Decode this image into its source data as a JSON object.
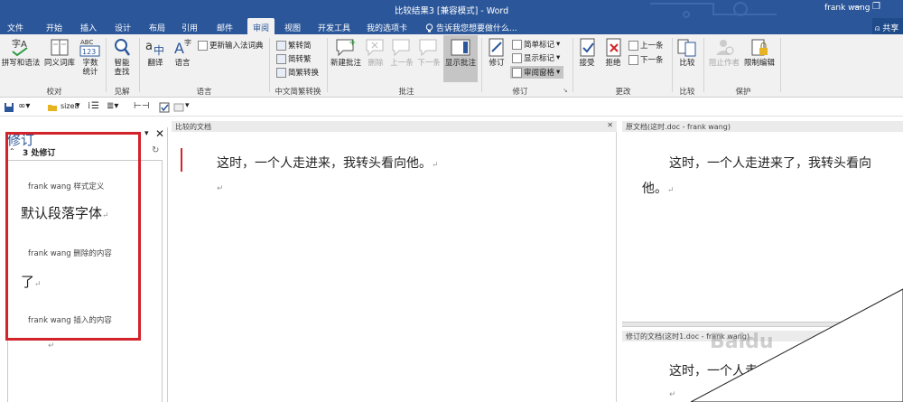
{
  "window": {
    "title": "比较结果3 [兼容模式] - Word",
    "user": "frank wang",
    "share": "共享"
  },
  "menu": {
    "items": [
      "文件",
      "开始",
      "插入",
      "设计",
      "布局",
      "引用",
      "邮件",
      "审阅",
      "视图",
      "开发工具",
      "我的选项卡"
    ],
    "active": "审阅",
    "tellme": "告诉我您想要做什么..."
  },
  "ribbon": {
    "proofing": {
      "spelling": "拼写和语法",
      "thesaurus": "同义词库",
      "wordcount_l1": "字数",
      "wordcount_l2": "统计",
      "label": "校对"
    },
    "insights": {
      "smart_l1": "智能",
      "smart_l2": "查找",
      "label": "见解"
    },
    "language": {
      "translate": "翻译",
      "language": "语言",
      "ime": "更新输入法词典",
      "label": "语言"
    },
    "chinese": {
      "to_trad": "繁转简",
      "to_simp": "简转繁",
      "convert": "简繁转换",
      "label": "中文简繁转换"
    },
    "comments": {
      "new": "新建批注",
      "delete": "删除",
      "prev": "上一条",
      "next": "下一条",
      "show": "显示批注",
      "label": "批注"
    },
    "tracking": {
      "track": "修订",
      "markup": "简单标记",
      "show_markup": "显示标记",
      "pane": "审阅窗格",
      "label": "修订"
    },
    "changes": {
      "accept": "接受",
      "reject": "拒绝",
      "prev": "上一条",
      "next": "下一条",
      "label": "更改"
    },
    "compare": {
      "compare": "比较",
      "label": "比较"
    },
    "protect": {
      "block": "阻止作者",
      "restrict": "限制编辑",
      "label": "保护"
    }
  },
  "qat": {
    "size_label": "size8"
  },
  "revision_pane": {
    "title": "修订",
    "count": "3 处修订",
    "items": [
      {
        "author": "frank wang 样式定义",
        "content": "默认段落字体"
      },
      {
        "author": "frank wang 删除的内容",
        "content": "了"
      },
      {
        "author": "frank wang 插入的内容",
        "content": ""
      }
    ]
  },
  "compared_doc": {
    "title": "比较的文档",
    "text": "这时，一个人走进来，我转头看向他。"
  },
  "original_doc": {
    "title": "原文档(这时.doc - frank wang)",
    "line1": "这时，一个人走进来了，我转头看向",
    "line2": "他。"
  },
  "revised_doc": {
    "title": "修订的文档(这时1.doc - frank wang)",
    "text": "这时，一个人走"
  },
  "watermark": "Baidu"
}
